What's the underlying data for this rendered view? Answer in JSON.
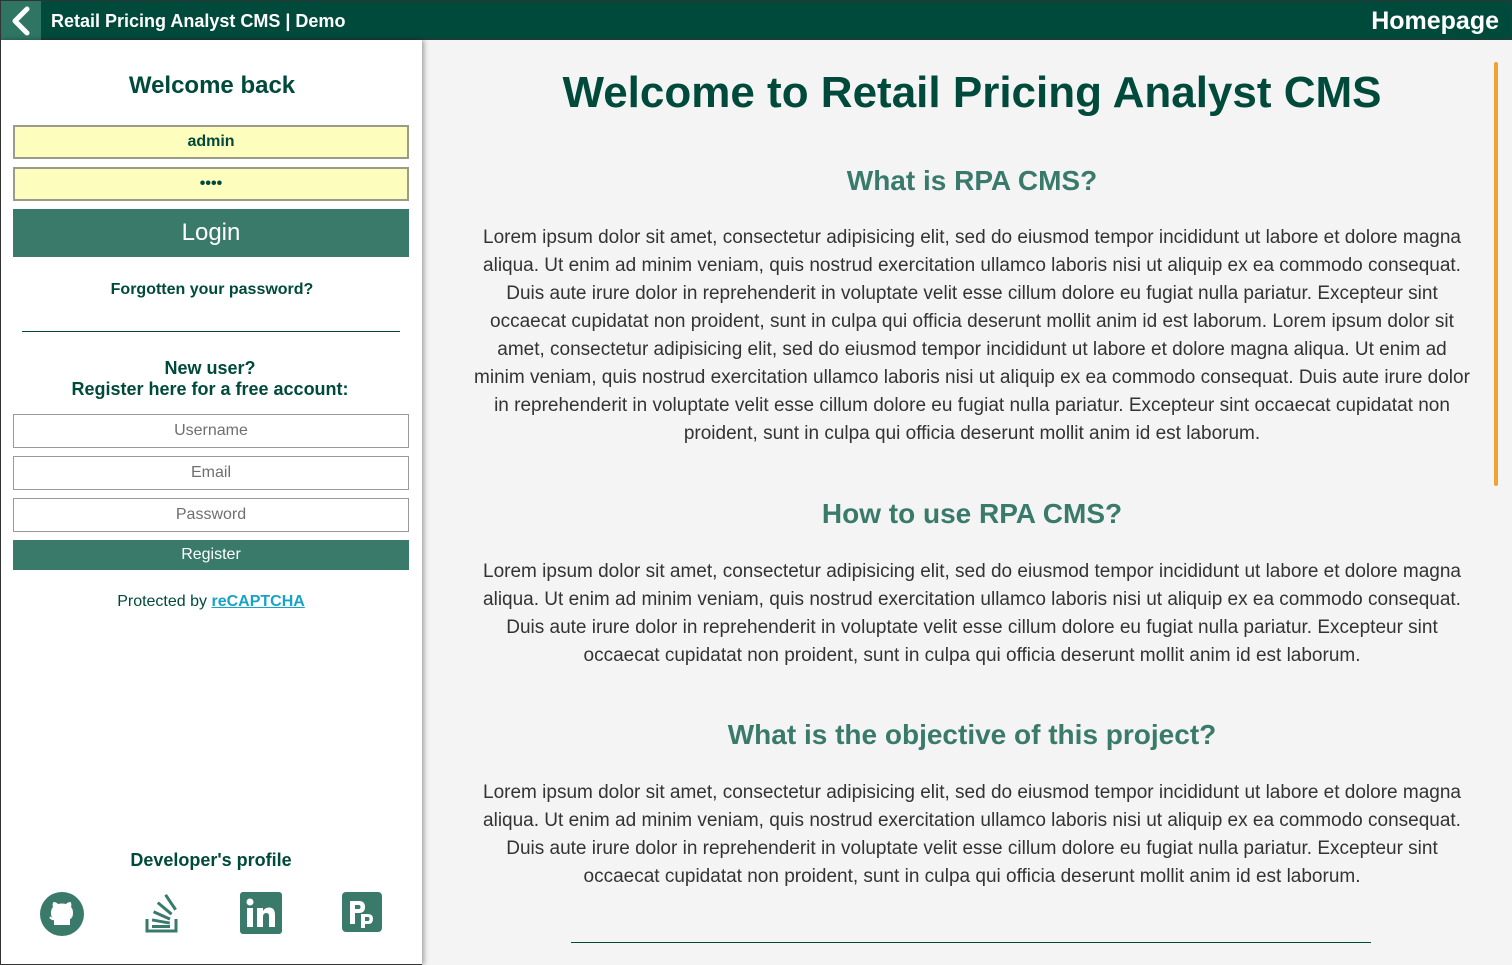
{
  "header": {
    "title": "Retail Pricing Analyst CMS | Demo",
    "page_label": "Homepage",
    "back_icon": "chevron-left-icon"
  },
  "sidebar": {
    "welcome": "Welcome back",
    "login": {
      "username_value": "admin",
      "password_value": "••••",
      "button_label": "Login",
      "forgot_label": "Forgotten your password?"
    },
    "register": {
      "prompt_line1": "New user?",
      "prompt_line2": "Register here for a free account:",
      "username_placeholder": "Username",
      "email_placeholder": "Email",
      "password_placeholder": "Password",
      "button_label": "Register"
    },
    "recaptcha": {
      "prefix": "Protected by ",
      "link": "reCAPTCHA"
    },
    "developer": {
      "title": "Developer's profile",
      "links": [
        "github-icon",
        "stackoverflow-icon",
        "linkedin-icon",
        "portfolio-icon"
      ]
    }
  },
  "main": {
    "title": "Welcome to Retail Pricing Analyst CMS",
    "sections": [
      {
        "heading": "What is RPA CMS?",
        "body": "Lorem ipsum dolor sit amet, consectetur adipisicing elit, sed do eiusmod tempor incididunt ut labore et dolore magna aliqua. Ut enim ad minim veniam, quis nostrud exercitation ullamco laboris nisi ut aliquip ex ea commodo consequat. Duis aute irure dolor in reprehenderit in voluptate velit esse cillum dolore eu fugiat nulla pariatur. Excepteur sint occaecat cupidatat non proident, sunt in culpa qui officia deserunt mollit anim id est laborum. Lorem ipsum dolor sit amet, consectetur adipisicing elit, sed do eiusmod tempor incididunt ut labore et dolore magna aliqua. Ut enim ad minim veniam, quis nostrud exercitation ullamco laboris nisi ut aliquip ex ea commodo consequat. Duis aute irure dolor in reprehenderit in voluptate velit esse cillum dolore eu fugiat nulla pariatur. Excepteur sint occaecat cupidatat non proident, sunt in culpa qui officia deserunt mollit anim id est laborum."
      },
      {
        "heading": "How to use RPA CMS?",
        "body": "Lorem ipsum dolor sit amet, consectetur adipisicing elit, sed do eiusmod tempor incididunt ut labore et dolore magna aliqua. Ut enim ad minim veniam, quis nostrud exercitation ullamco laboris nisi ut aliquip ex ea commodo consequat. Duis aute irure dolor in reprehenderit in voluptate velit esse cillum dolore eu fugiat nulla pariatur. Excepteur sint occaecat cupidatat non proident, sunt in culpa qui officia deserunt mollit anim id est laborum."
      },
      {
        "heading": "What is the objective of this project?",
        "body": "Lorem ipsum dolor sit amet, consectetur adipisicing elit, sed do eiusmod tempor incididunt ut labore et dolore magna aliqua. Ut enim ad minim veniam, quis nostrud exercitation ullamco laboris nisi ut aliquip ex ea commodo consequat. Duis aute irure dolor in reprehenderit in voluptate velit esse cillum dolore eu fugiat nulla pariatur. Excepteur sint occaecat cupidatat non proident, sunt in culpa qui officia deserunt mollit anim id est laborum."
      }
    ]
  },
  "colors": {
    "brand_dark": "#004a3c",
    "brand_mid": "#3a7a6a",
    "login_field_bg": "#fdfdbd",
    "link": "#17a2c8",
    "scrollbar": "#f2a232"
  }
}
